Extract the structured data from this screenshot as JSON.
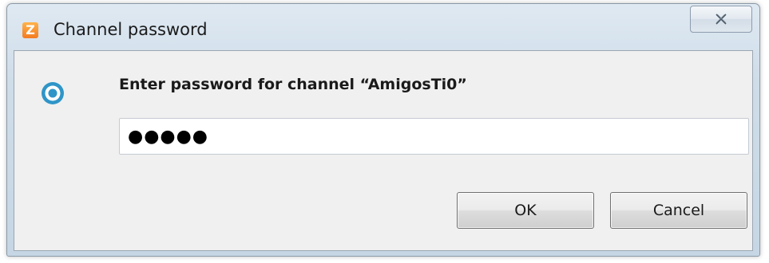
{
  "window": {
    "title": "Channel password",
    "app_icon_letter": "Z",
    "close_symbol": "×"
  },
  "dialog": {
    "prompt": "Enter password for channel “AmigosTi0”",
    "password_value": "●●●●●",
    "ok_label": "OK",
    "cancel_label": "Cancel"
  },
  "colors": {
    "info_icon": "#2f95c8",
    "app_icon": "#f47b20",
    "titlebar": "#cfdde9",
    "client_bg": "#f0f0f0"
  },
  "icons": {
    "app": "app-z-icon",
    "info": "info-target-icon",
    "close": "close-icon"
  }
}
